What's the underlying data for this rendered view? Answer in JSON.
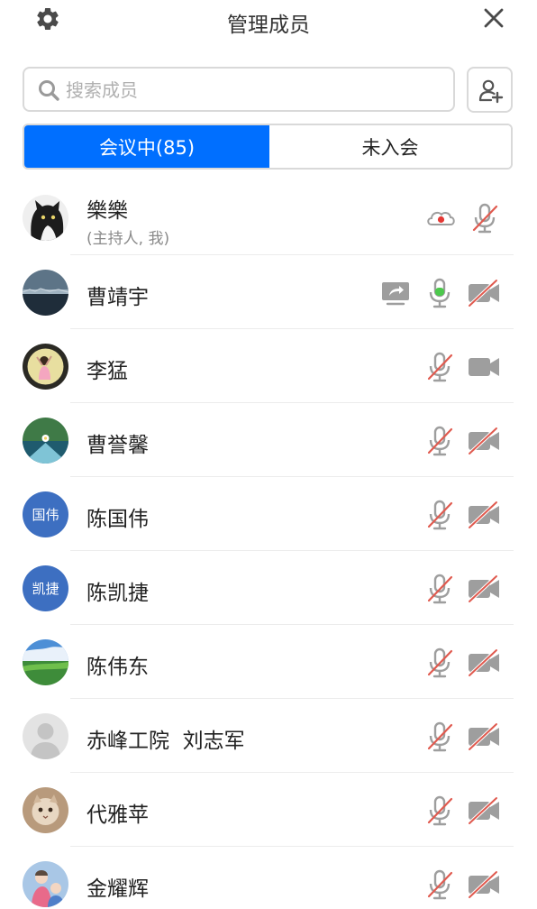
{
  "header": {
    "title": "管理成员",
    "settings_icon": "gear-icon",
    "close_icon": "close-icon"
  },
  "search": {
    "placeholder": "搜索成员",
    "value": ""
  },
  "add_member_icon": "add-user-icon",
  "tabs": [
    {
      "label": "会议中(85)",
      "active": true
    },
    {
      "label": "未入会",
      "active": false
    }
  ],
  "colors": {
    "accent": "#006fff",
    "muted_red": "#e05a4f",
    "icon_gray": "#9e9e9e",
    "mic_active_green": "#4cc94c",
    "recording_red": "#e53935"
  },
  "members": [
    {
      "name": "樂樂",
      "role": "(主持人, 我)",
      "avatar": "photo-cat",
      "recording": true,
      "sharing": false,
      "mic": "muted",
      "camera": "none"
    },
    {
      "name": "曹靖宇",
      "role": "",
      "avatar": "photo-sea",
      "recording": false,
      "sharing": true,
      "mic": "active",
      "camera": "off"
    },
    {
      "name": "李猛",
      "role": "",
      "avatar": "photo-child",
      "recording": false,
      "sharing": false,
      "mic": "muted",
      "camera": "on"
    },
    {
      "name": "曹誉馨",
      "role": "",
      "avatar": "photo-flower",
      "recording": false,
      "sharing": false,
      "mic": "muted",
      "camera": "off"
    },
    {
      "name": "陈国伟",
      "role": "",
      "avatar_text": "国伟",
      "recording": false,
      "sharing": false,
      "mic": "muted",
      "camera": "off"
    },
    {
      "name": "陈凯捷",
      "role": "",
      "avatar_text": "凯捷",
      "recording": false,
      "sharing": false,
      "mic": "muted",
      "camera": "off"
    },
    {
      "name": "陈伟东",
      "role": "",
      "avatar": "photo-landscape",
      "recording": false,
      "sharing": false,
      "mic": "muted",
      "camera": "off"
    },
    {
      "name": "赤峰工院  刘志军",
      "role": "",
      "avatar": "default-person",
      "recording": false,
      "sharing": false,
      "mic": "muted",
      "camera": "off"
    },
    {
      "name": "代雅苹",
      "role": "",
      "avatar": "photo-kitten",
      "recording": false,
      "sharing": false,
      "mic": "muted",
      "camera": "off"
    },
    {
      "name": "金耀辉",
      "role": "",
      "avatar": "photo-cartoon",
      "recording": false,
      "sharing": false,
      "mic": "muted",
      "camera": "off"
    }
  ]
}
